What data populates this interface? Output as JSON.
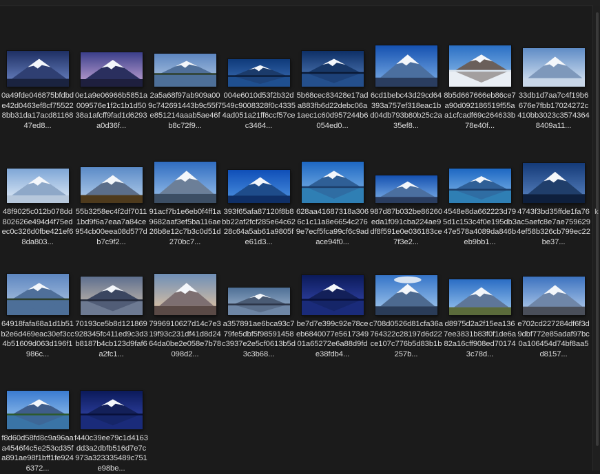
{
  "files": [
    {
      "name": "0a49fde046875bfdbde42d0463ef8cf755228bb31da17acd8116847ed8...",
      "scene": "dusk"
    },
    {
      "name": "0e1a9e06966b5851a009576e1f2c1b1d5038a1afcff9fad1d6293a0d36f...",
      "scene": "twilight"
    },
    {
      "name": "2a5a68f97ab909a009c742691443b9c55f7e851214aaab5ae46fb8c72f9...",
      "scene": "lake-day"
    },
    {
      "name": "004e6010d53f2b32d549c9008328f0c43354ad051a21ff6ccf57cec3464...",
      "scene": "reflection-blue"
    },
    {
      "name": "5b68cec83428e17ada883fb6d22debc06a1aec1c60d957244b6054ed0...",
      "scene": "reflection-deep"
    },
    {
      "name": "6cd1bebc43d29cd64393a757ef318eac1bd04db793b80b25c2a35ef8...",
      "scene": "clear-blue"
    },
    {
      "name": "8b5d667666eb86ce7a90d092186519f55aa1cfcadf69c264633b78e40f...",
      "scene": "cloud-sea"
    },
    {
      "name": "33db1d7aa7c4f19b6676e7fbb17024272c410bb3023c35743648409a11...",
      "scene": "misty"
    },
    {
      "name": "48f9025c012b078dd802626e494d4f75edec0c326d0fbe421ef68da803...",
      "scene": "pale"
    },
    {
      "name": "55b3258ec4f2df70111bd9f6a7eaa7a84ce954cb00eea08d577db7c9f2...",
      "scene": "autumn"
    },
    {
      "name": "91acf7b1e6eb0f4ff1a9682aaf3ef5ba116ae26b8e12c7b3c0d51d270bc7...",
      "scene": "close-snow"
    },
    {
      "name": "393f65afa87120f8b8bb22af2fcf285e64c6228c64a5ab61a9805fe61d3...",
      "scene": "vivid-blue"
    },
    {
      "name": "628aa41687318a3066c1c11a8e6654c2769e7ecf5fca99cf6c9adace94f0...",
      "scene": "lake-cyan"
    },
    {
      "name": "987d87b032be86260eda1f091cba224ae9df8f591e0e036183ce7f3e2...",
      "scene": "clear-blue"
    },
    {
      "name": "4548e8da662223d795d1c153c4f0e195db347e578a4089da846beb9bb1...",
      "scene": "lake-cyan"
    },
    {
      "name": "4743f3bd35ffde1fa76ac5aefc8e7ae7596294ef58b326cb799ec22be37...",
      "scene": "dark-blue"
    },
    {
      "name": "64918fafa68a1d1b51b2e6d469eac30ef3cc4b51609d063d196f1986c...",
      "scene": "lake-day"
    },
    {
      "name": "70193ce5b8d121869928345fc411ed9c3d3b8187b4cb123d9faf6a2fc1...",
      "scene": "dusk-lake"
    },
    {
      "name": "7996910627d14c7e319f93c231df41d8d2464da0be2e058e7b78098d2...",
      "scene": "sunset-snow"
    },
    {
      "name": "a357891ae6bca93c779fe5dbf5f98591458c3937e2e5cf0613b5d3c3b68...",
      "scene": "reflection-grey"
    },
    {
      "name": "be7d7e399c92e78ceeb6840077e561734901a65272e6a88d9fde38fdb4...",
      "scene": "night-reflection"
    },
    {
      "name": "c708d0526d81cfa36a764322c28197d6d22ce107c776b5d83b1b257b...",
      "scene": "lenticular"
    },
    {
      "name": "d8975d2a2f15ea1367ee3831b83f0f1de6a82a16cff908ed701743c78d...",
      "scene": "field"
    },
    {
      "name": "e702cd227284df6f3d9dbf772e85adaf97bc0a106454d74bf8aa5d8157...",
      "scene": "city-far"
    },
    {
      "name": "f8d60d58fd8c9a96aaa4546f4c5e253cd35fa891ae98f1bff1fe9246372...",
      "scene": "green-lake"
    },
    {
      "name": "f440c39ee79c1d4163dd3a2dbfb516d7e7c973a323335489c751e98be...",
      "scene": "night-reflection"
    }
  ],
  "colors": {
    "background": "#1b1b1b",
    "label_text": "#dcdcdc"
  }
}
